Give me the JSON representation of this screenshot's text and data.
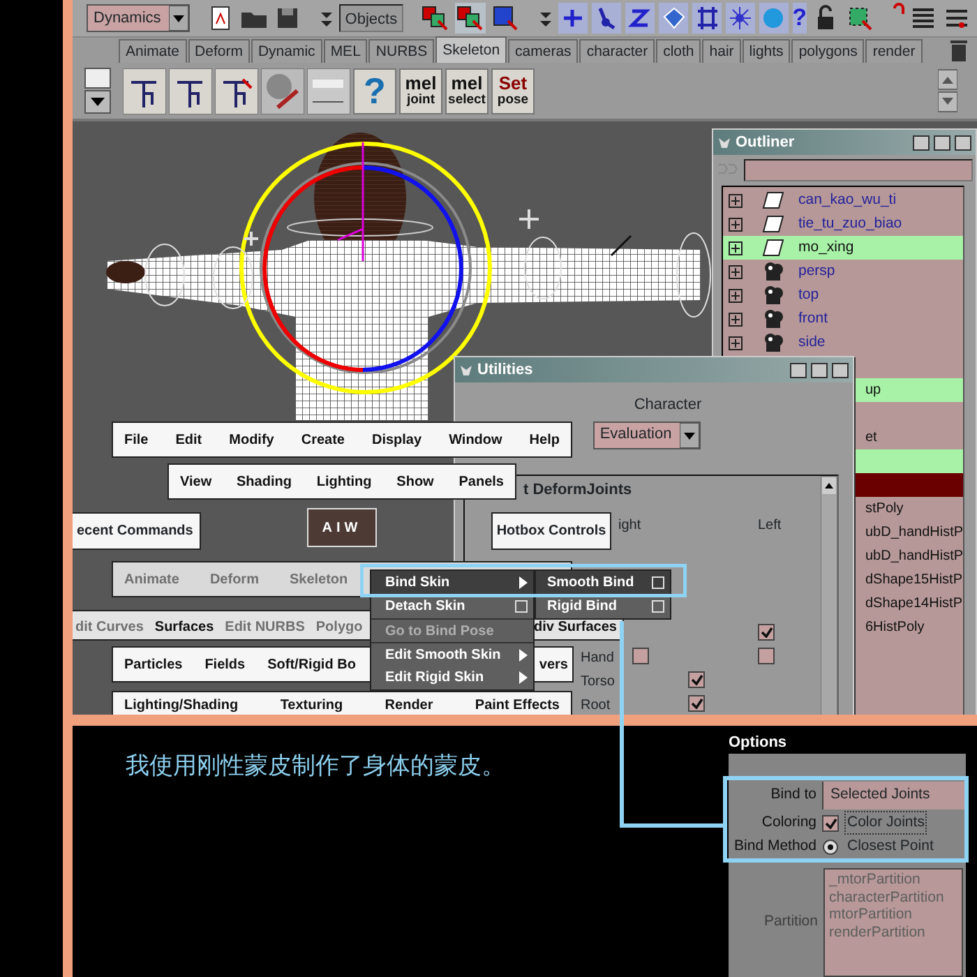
{
  "toolbar": {
    "menu_set": "Dynamics",
    "selection_mode": "Objects",
    "help_glyph": "?"
  },
  "shelf_tabs": [
    {
      "label": "Animate",
      "selected": false
    },
    {
      "label": "Deform",
      "selected": false
    },
    {
      "label": "Dynamic",
      "selected": false
    },
    {
      "label": "MEL",
      "selected": false
    },
    {
      "label": "NURBS",
      "selected": false
    },
    {
      "label": "Skeleton",
      "selected": true
    },
    {
      "label": "cameras",
      "selected": false
    },
    {
      "label": "character",
      "selected": false
    },
    {
      "label": "cloth",
      "selected": false
    },
    {
      "label": "hair",
      "selected": false
    },
    {
      "label": "lights",
      "selected": false
    },
    {
      "label": "polygons",
      "selected": false
    },
    {
      "label": "render",
      "selected": false
    }
  ],
  "shelf": {
    "help_glyph": "?",
    "text_buttons": [
      {
        "top": "mel",
        "bottom": "joint"
      },
      {
        "top": "mel",
        "bottom": "select"
      },
      {
        "top": "Set",
        "bottom": "pose"
      }
    ]
  },
  "outliner": {
    "title": "Outliner",
    "rows": [
      {
        "text": "can_kao_wu_ti",
        "kind": "layer",
        "selected": false,
        "active": false
      },
      {
        "text": "tie_tu_zuo_biao",
        "kind": "layer",
        "selected": false,
        "active": false
      },
      {
        "text": "mo_xing",
        "kind": "layer",
        "selected": true,
        "active": false
      },
      {
        "text": "persp",
        "kind": "camera",
        "selected": false,
        "active": false
      },
      {
        "text": "top",
        "kind": "camera",
        "selected": false,
        "active": false
      },
      {
        "text": "front",
        "kind": "camera",
        "selected": false,
        "active": false
      },
      {
        "text": "side",
        "kind": "camera",
        "selected": false,
        "active": false
      },
      {
        "kind": "hidden",
        "selected": false,
        "active": false
      },
      {
        "text": "up",
        "kind": "hidden",
        "selected": true,
        "active": false
      },
      {
        "kind": "hidden",
        "selected": false,
        "active": false
      },
      {
        "text": "et",
        "kind": "hidden",
        "selected": false,
        "active": false
      },
      {
        "kind": "hidden",
        "selected": true,
        "active": false
      },
      {
        "kind": "hidden",
        "selected": false,
        "active": true
      },
      {
        "text": "stPoly",
        "kind": "hidden",
        "selected": false,
        "active": false
      },
      {
        "text": "ubD_handHistP",
        "kind": "hidden",
        "selected": false,
        "active": false
      },
      {
        "text": "ubD_handHistP",
        "kind": "hidden",
        "selected": false,
        "active": false
      },
      {
        "text": "dShape15HistP",
        "kind": "hidden",
        "selected": false,
        "active": false
      },
      {
        "text": "dShape14HistP",
        "kind": "hidden",
        "selected": false,
        "active": false
      },
      {
        "text": "6HistPoly",
        "kind": "hidden",
        "selected": false,
        "active": false
      }
    ]
  },
  "utilities": {
    "title": "Utilities",
    "character_label": "Character",
    "character_value": "Evaluation",
    "section": "t DeformJoints",
    "columns": [
      "ight",
      "Left"
    ],
    "rows": [
      {
        "left": true
      },
      {
        "label": "Hand",
        "right": false,
        "left": false
      },
      {
        "label": "Torso",
        "middle": true
      },
      {
        "label": "Root",
        "middle": true
      }
    ]
  },
  "hotbox": {
    "recent_commands": "ecent Commands",
    "center_label": "AIW",
    "controls": "Hotbox Controls",
    "menu_rows": [
      {
        "kind": "main",
        "items": [
          {
            "label": "File",
            "dimmed": false
          },
          {
            "label": "Edit",
            "dimmed": false
          },
          {
            "label": "Modify",
            "dimmed": false
          },
          {
            "label": "Create",
            "dimmed": false
          },
          {
            "label": "Display",
            "dimmed": false
          },
          {
            "label": "Window",
            "dimmed": false
          },
          {
            "label": "Help",
            "dimmed": false
          }
        ]
      },
      {
        "kind": "view",
        "items": [
          {
            "label": "View",
            "dimmed": false
          },
          {
            "label": "Shading",
            "dimmed": false
          },
          {
            "label": "Lighting",
            "dimmed": false
          },
          {
            "label": "Show",
            "dimmed": false
          },
          {
            "label": "Panels",
            "dimmed": false
          }
        ]
      },
      {
        "kind": "animation",
        "items": [
          {
            "label": "Animate",
            "dimmed": true
          },
          {
            "label": "Deform",
            "dimmed": true
          },
          {
            "label": "Skeleton",
            "dimmed": true
          }
        ]
      },
      {
        "kind": "modeling",
        "items": [
          {
            "label": "dit Curves",
            "dimmed": true
          },
          {
            "label": "Surfaces",
            "dimmed": false
          },
          {
            "label": "Edit NURBS",
            "dimmed": true
          },
          {
            "label": "Polygo",
            "dimmed": true
          },
          {
            "label": "div Surfaces",
            "dimmed": false
          }
        ]
      },
      {
        "kind": "dynamics",
        "items": [
          {
            "label": "Particles",
            "dimmed": false
          },
          {
            "label": "Fields",
            "dimmed": false
          },
          {
            "label": "Soft/Rigid Bo",
            "dimmed": false
          },
          {
            "label": "vers",
            "dimmed": false
          }
        ]
      },
      {
        "kind": "rendering",
        "items": [
          {
            "label": "Lighting/Shading",
            "dimmed": false
          },
          {
            "label": "Texturing",
            "dimmed": false
          },
          {
            "label": "Render",
            "dimmed": false
          },
          {
            "label": "Paint Effects",
            "dimmed": false
          }
        ]
      }
    ]
  },
  "skin_menu": {
    "items": [
      {
        "label": "Bind Skin",
        "kind": "submenu",
        "selected": true,
        "disabled": false
      },
      {
        "label": "Detach Skin",
        "kind": "option",
        "selected": false,
        "disabled": false
      },
      {
        "label": "Go to Bind Pose",
        "kind": "plain",
        "selected": false,
        "disabled": true
      },
      {
        "label": "Edit Smooth Skin",
        "kind": "submenu",
        "selected": false,
        "disabled": false
      },
      {
        "label": "Edit Rigid Skin",
        "kind": "submenu",
        "selected": false,
        "disabled": false
      }
    ],
    "submenu": [
      {
        "label": "Smooth Bind",
        "selected": true
      },
      {
        "label": "Rigid Bind",
        "selected": false
      }
    ]
  },
  "caption": "我使用刚性蒙皮制作了身体的蒙皮。",
  "options": {
    "title": "Options",
    "fields": [
      {
        "label": "Bind to",
        "kind": "dropdown",
        "value": "Selected Joints"
      },
      {
        "label": "Coloring",
        "kind": "checkbox",
        "checked": true,
        "value": "Color Joints"
      },
      {
        "label": "Bind Method",
        "kind": "radio",
        "selected": true,
        "value": "Closest Point"
      }
    ],
    "partition": {
      "label": "Partition",
      "items": [
        "_mtorPartition",
        "characterPartition",
        "mtorPartition",
        "renderPartition"
      ]
    }
  }
}
